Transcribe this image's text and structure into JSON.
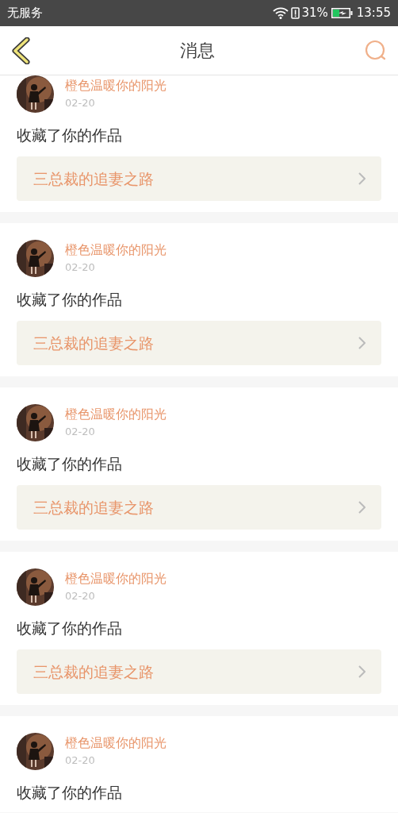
{
  "status_bar": {
    "carrier": "无服务",
    "battery_percent": "31%",
    "time": "13:55"
  },
  "header": {
    "title": "消息"
  },
  "messages": [
    {
      "user": "橙色温暖你的阳光",
      "date": "02-20",
      "action": "收藏了你的作品",
      "work": "三总裁的追妻之路"
    },
    {
      "user": "橙色温暖你的阳光",
      "date": "02-20",
      "action": "收藏了你的作品",
      "work": "三总裁的追妻之路"
    },
    {
      "user": "橙色温暖你的阳光",
      "date": "02-20",
      "action": "收藏了你的作品",
      "work": "三总裁的追妻之路"
    },
    {
      "user": "橙色温暖你的阳光",
      "date": "02-20",
      "action": "收藏了你的作品",
      "work": "三总裁的追妻之路"
    },
    {
      "user": "橙色温暖你的阳光",
      "date": "02-20",
      "action": "收藏了你的作品"
    }
  ]
}
